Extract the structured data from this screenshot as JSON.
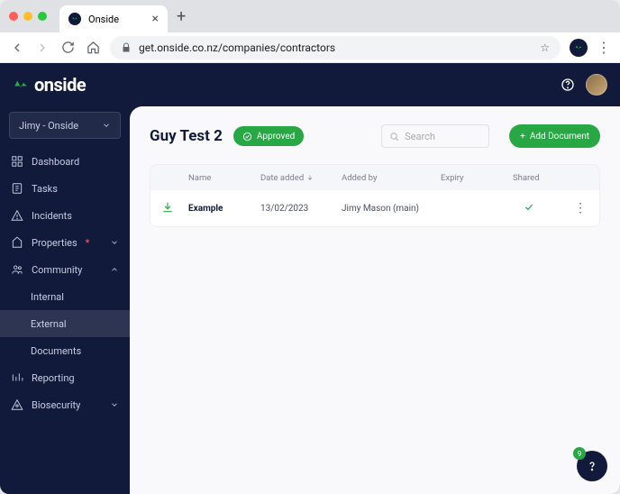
{
  "browser": {
    "tab_title": "Onside",
    "url": "get.onside.co.nz/companies/contractors"
  },
  "brand": "onside",
  "workspace": "Jimy - Onside",
  "nav": {
    "dashboard": "Dashboard",
    "tasks": "Tasks",
    "incidents": "Incidents",
    "properties": "Properties",
    "community": "Community",
    "internal": "Internal",
    "external": "External",
    "documents": "Documents",
    "reporting": "Reporting",
    "biosecurity": "Biosecurity"
  },
  "page": {
    "title": "Guy Test 2",
    "status": "Approved",
    "search_placeholder": "Search",
    "add_button": "Add Document"
  },
  "table": {
    "headers": {
      "name": "Name",
      "date_added": "Date added",
      "added_by": "Added by",
      "expiry": "Expiry",
      "shared": "Shared"
    },
    "rows": [
      {
        "name": "Example",
        "date_added": "13/02/2023",
        "added_by": "Jimy Mason (main)",
        "expiry": "",
        "shared": true
      }
    ]
  },
  "float_badge": "9"
}
